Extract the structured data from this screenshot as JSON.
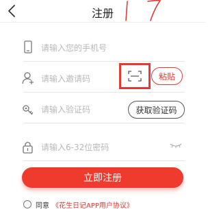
{
  "header": {
    "title": "注册"
  },
  "form": {
    "phone_placeholder": "请输入您的手机号",
    "invite_placeholder": "请输入邀请码",
    "paste_label": "粘贴",
    "code_placeholder": "请输入验证码",
    "get_code_label": "获取验证码",
    "password_placeholder": "请输入6-32位密码",
    "submit_label": "立即注册"
  },
  "agreement": {
    "prefix": "同意",
    "link": "《花生日记APP用户协议》"
  },
  "colors": {
    "accent": "#ef3b2d",
    "annotation": "#e53935"
  },
  "icons": [
    "back-icon",
    "phone-icon",
    "user-add-icon",
    "scan-icon",
    "key-icon",
    "lock-icon",
    "eye-closed-icon"
  ]
}
